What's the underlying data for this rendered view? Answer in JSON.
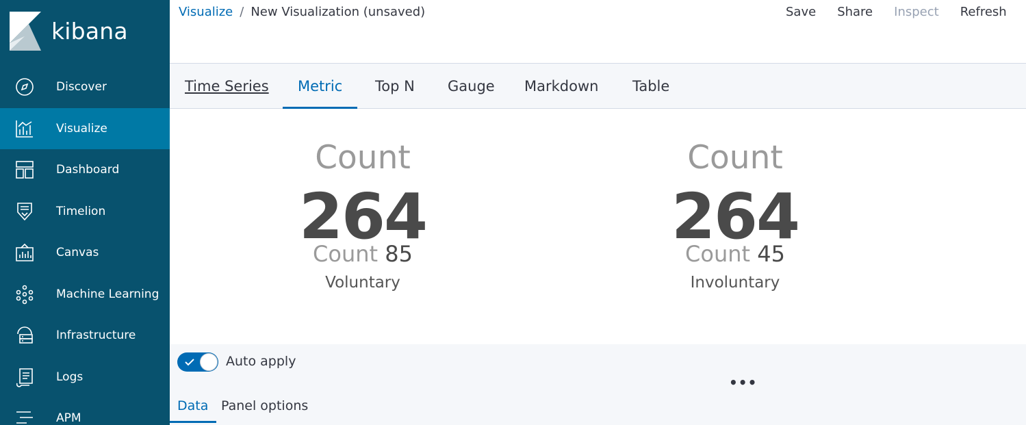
{
  "app": {
    "name": "kibana"
  },
  "sidebar": {
    "items": [
      {
        "label": "Discover",
        "icon": "compass-icon"
      },
      {
        "label": "Visualize",
        "icon": "visualize-icon",
        "active": true
      },
      {
        "label": "Dashboard",
        "icon": "dashboard-icon"
      },
      {
        "label": "Timelion",
        "icon": "timelion-icon"
      },
      {
        "label": "Canvas",
        "icon": "canvas-icon"
      },
      {
        "label": "Machine Learning",
        "icon": "machine-learning-icon"
      },
      {
        "label": "Infrastructure",
        "icon": "infrastructure-icon"
      },
      {
        "label": "Logs",
        "icon": "logs-icon"
      },
      {
        "label": "APM",
        "icon": "apm-icon"
      }
    ]
  },
  "breadcrumbs": {
    "parent": "Visualize",
    "separator": "/",
    "current": "New Visualization (unsaved)"
  },
  "top_menu": {
    "save": "Save",
    "share": "Share",
    "inspect": "Inspect",
    "refresh": "Refresh"
  },
  "tabs": [
    {
      "label": "Time Series"
    },
    {
      "label": "Metric",
      "active": true
    },
    {
      "label": "Top N"
    },
    {
      "label": "Gauge"
    },
    {
      "label": "Markdown"
    },
    {
      "label": "Table"
    }
  ],
  "metrics": [
    {
      "title": "Count",
      "value": "264",
      "secondary_label": "Count",
      "secondary_value": "85",
      "label": "Voluntary"
    },
    {
      "title": "Count",
      "value": "264",
      "secondary_label": "Count",
      "secondary_value": "45",
      "label": "Involuntary"
    }
  ],
  "panel": {
    "auto_apply_label": "Auto apply",
    "auto_apply_on": true,
    "more": "•••",
    "tabs": {
      "data": "Data",
      "options": "Panel options"
    }
  },
  "colors": {
    "sidebar": "#08526e",
    "sidebar_active": "#0079a5",
    "accent": "#006bb4"
  }
}
